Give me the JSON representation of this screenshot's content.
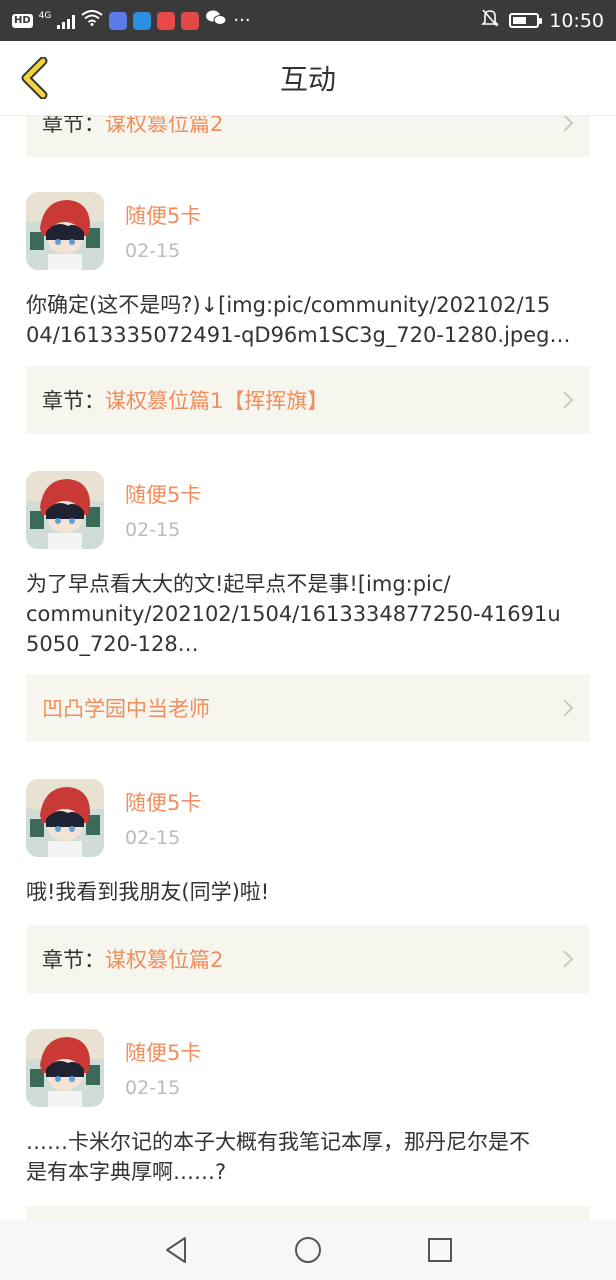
{
  "status_bar": {
    "hd": "HD",
    "network": "4G",
    "more": "···",
    "time": "10:50",
    "battery_level": 0.6
  },
  "header": {
    "title": "互动"
  },
  "chapter_key": "章节：",
  "top_partial": {
    "chapter": "谋权篡位篇2"
  },
  "posts": [
    {
      "user": "随便5卡",
      "date": "02-15",
      "lines": [
        "你确定(这不是吗?)↓[img:pic/community/202102/15",
        "04/1613335072491-qD96m1SC3g_720-1280.jpeg…"
      ],
      "chapter": "谋权篡位篇1【挥挥旗】"
    },
    {
      "user": "随便5卡",
      "date": "02-15",
      "lines": [
        "为了早点看大大的文!起早点不是事![img:pic/",
        "community/202102/1504/1613334877250-41691u",
        "5050_720-128…"
      ],
      "link": "凹凸学园中当老师"
    },
    {
      "user": "随便5卡",
      "date": "02-15",
      "lines": [
        "哦!我看到我朋友(同学)啦!"
      ],
      "chapter": "谋权篡位篇2"
    },
    {
      "user": "随便5卡",
      "date": "02-15",
      "lines": [
        "……卡米尔记的本子大概有我笔记本厚，那丹尼尔是不",
        "是有本字典厚啊……?"
      ]
    }
  ],
  "colors": {
    "accent": "#ef8e5e",
    "chapter_bg": "#f6f5ee",
    "status_bar": "#3a3a3a",
    "back_arrow": "#f2d53c"
  }
}
